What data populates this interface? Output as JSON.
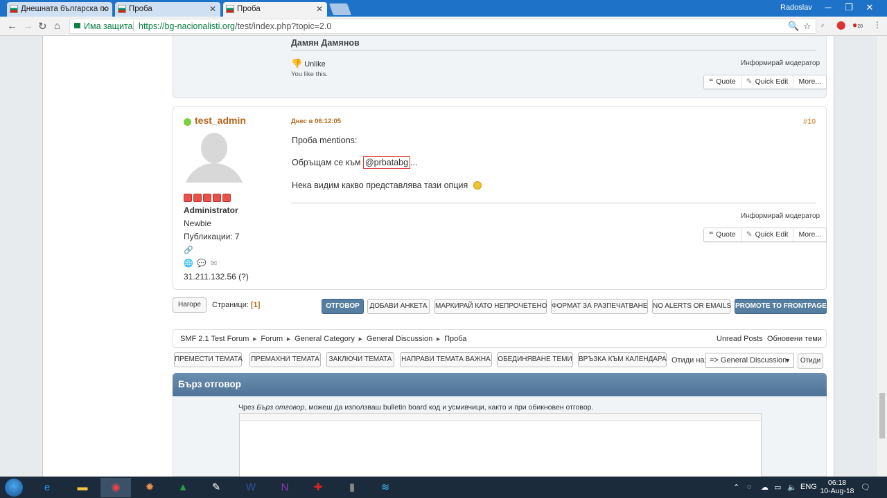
{
  "browser": {
    "tabs": [
      {
        "label": "Днешната българска по"
      },
      {
        "label": "Проба"
      },
      {
        "label": "Проба"
      }
    ],
    "user": "Radoslav",
    "security_label": "Има защита",
    "url_host": "https://bg-nacionalisti.org",
    "url_path": "/test/index.php?topic=2.0",
    "ext_badge": "20"
  },
  "post1": {
    "signature": "Дамян Дамянов",
    "unlike": "Unlike",
    "you_like": "You like this.",
    "report": "Информирай модератор",
    "quote": "Quote",
    "quick_edit": "Quick Edit",
    "more": "More..."
  },
  "post2": {
    "author": "test_admin",
    "date": "Днес в 06:12:05",
    "number": "#10",
    "group": "Administrator",
    "rank": "Newbie",
    "posts": "Публикации: 7",
    "ip": "31.211.132.56 (?)",
    "line1": "Проба mentions:",
    "line2_prefix": "Обръщам се към ",
    "mention": "@prbatabg",
    "line2_suffix": "...",
    "line3": "Нека видим  какво представлява тази опция",
    "report": "Информирай модератор",
    "quote": "Quote",
    "quick_edit": "Quick Edit",
    "more": "More..."
  },
  "pagebar": {
    "top": "Нагоре",
    "pages_label": "Страници:",
    "current_page": "[1]",
    "buttons": [
      "ОТГОВОР",
      "ДОБАВИ АНКЕТА",
      "МАРКИРАЙ КАТО НЕПРОЧЕТЕНО",
      "ФОРМАТ ЗА РАЗПЕЧАТВАНЕ",
      "NO ALERTS OR EMAILS",
      "PROMOTE TO FRONTPAGE"
    ]
  },
  "breadcrumb": {
    "items": [
      "SMF 2.1 Test Forum",
      "Forum",
      "General Category",
      "General Discussion",
      "Проба"
    ],
    "unread": "Unread Posts",
    "updated": "Обновени теми"
  },
  "modbar": {
    "buttons": [
      "ПРЕМЕСТИ ТЕМАТА",
      "ПРЕМАХНИ ТЕМАТА",
      "ЗАКЛЮЧИ ТЕМАТА",
      "НАПРАВИ ТЕМАТА ВАЖНА",
      "ОБЕДИНЯВАНЕ ТЕМИ",
      "ВРЪЗКА КЪМ КАЛЕНДАРА"
    ],
    "goto_label": "Отиди на:",
    "goto_value": "=> General Discussion",
    "goto_button": "Отиди"
  },
  "quick_reply": {
    "title": "Бърз отговор",
    "note_a": "Чрез ",
    "note_em": "Бърз отговор",
    "note_b": ", можеш да използваш bulletin board код и усмивчици, както и при обикновен отговор."
  },
  "taskbar": {
    "lang": "ENG",
    "time": "06:18",
    "date": "10-Aug-18"
  }
}
